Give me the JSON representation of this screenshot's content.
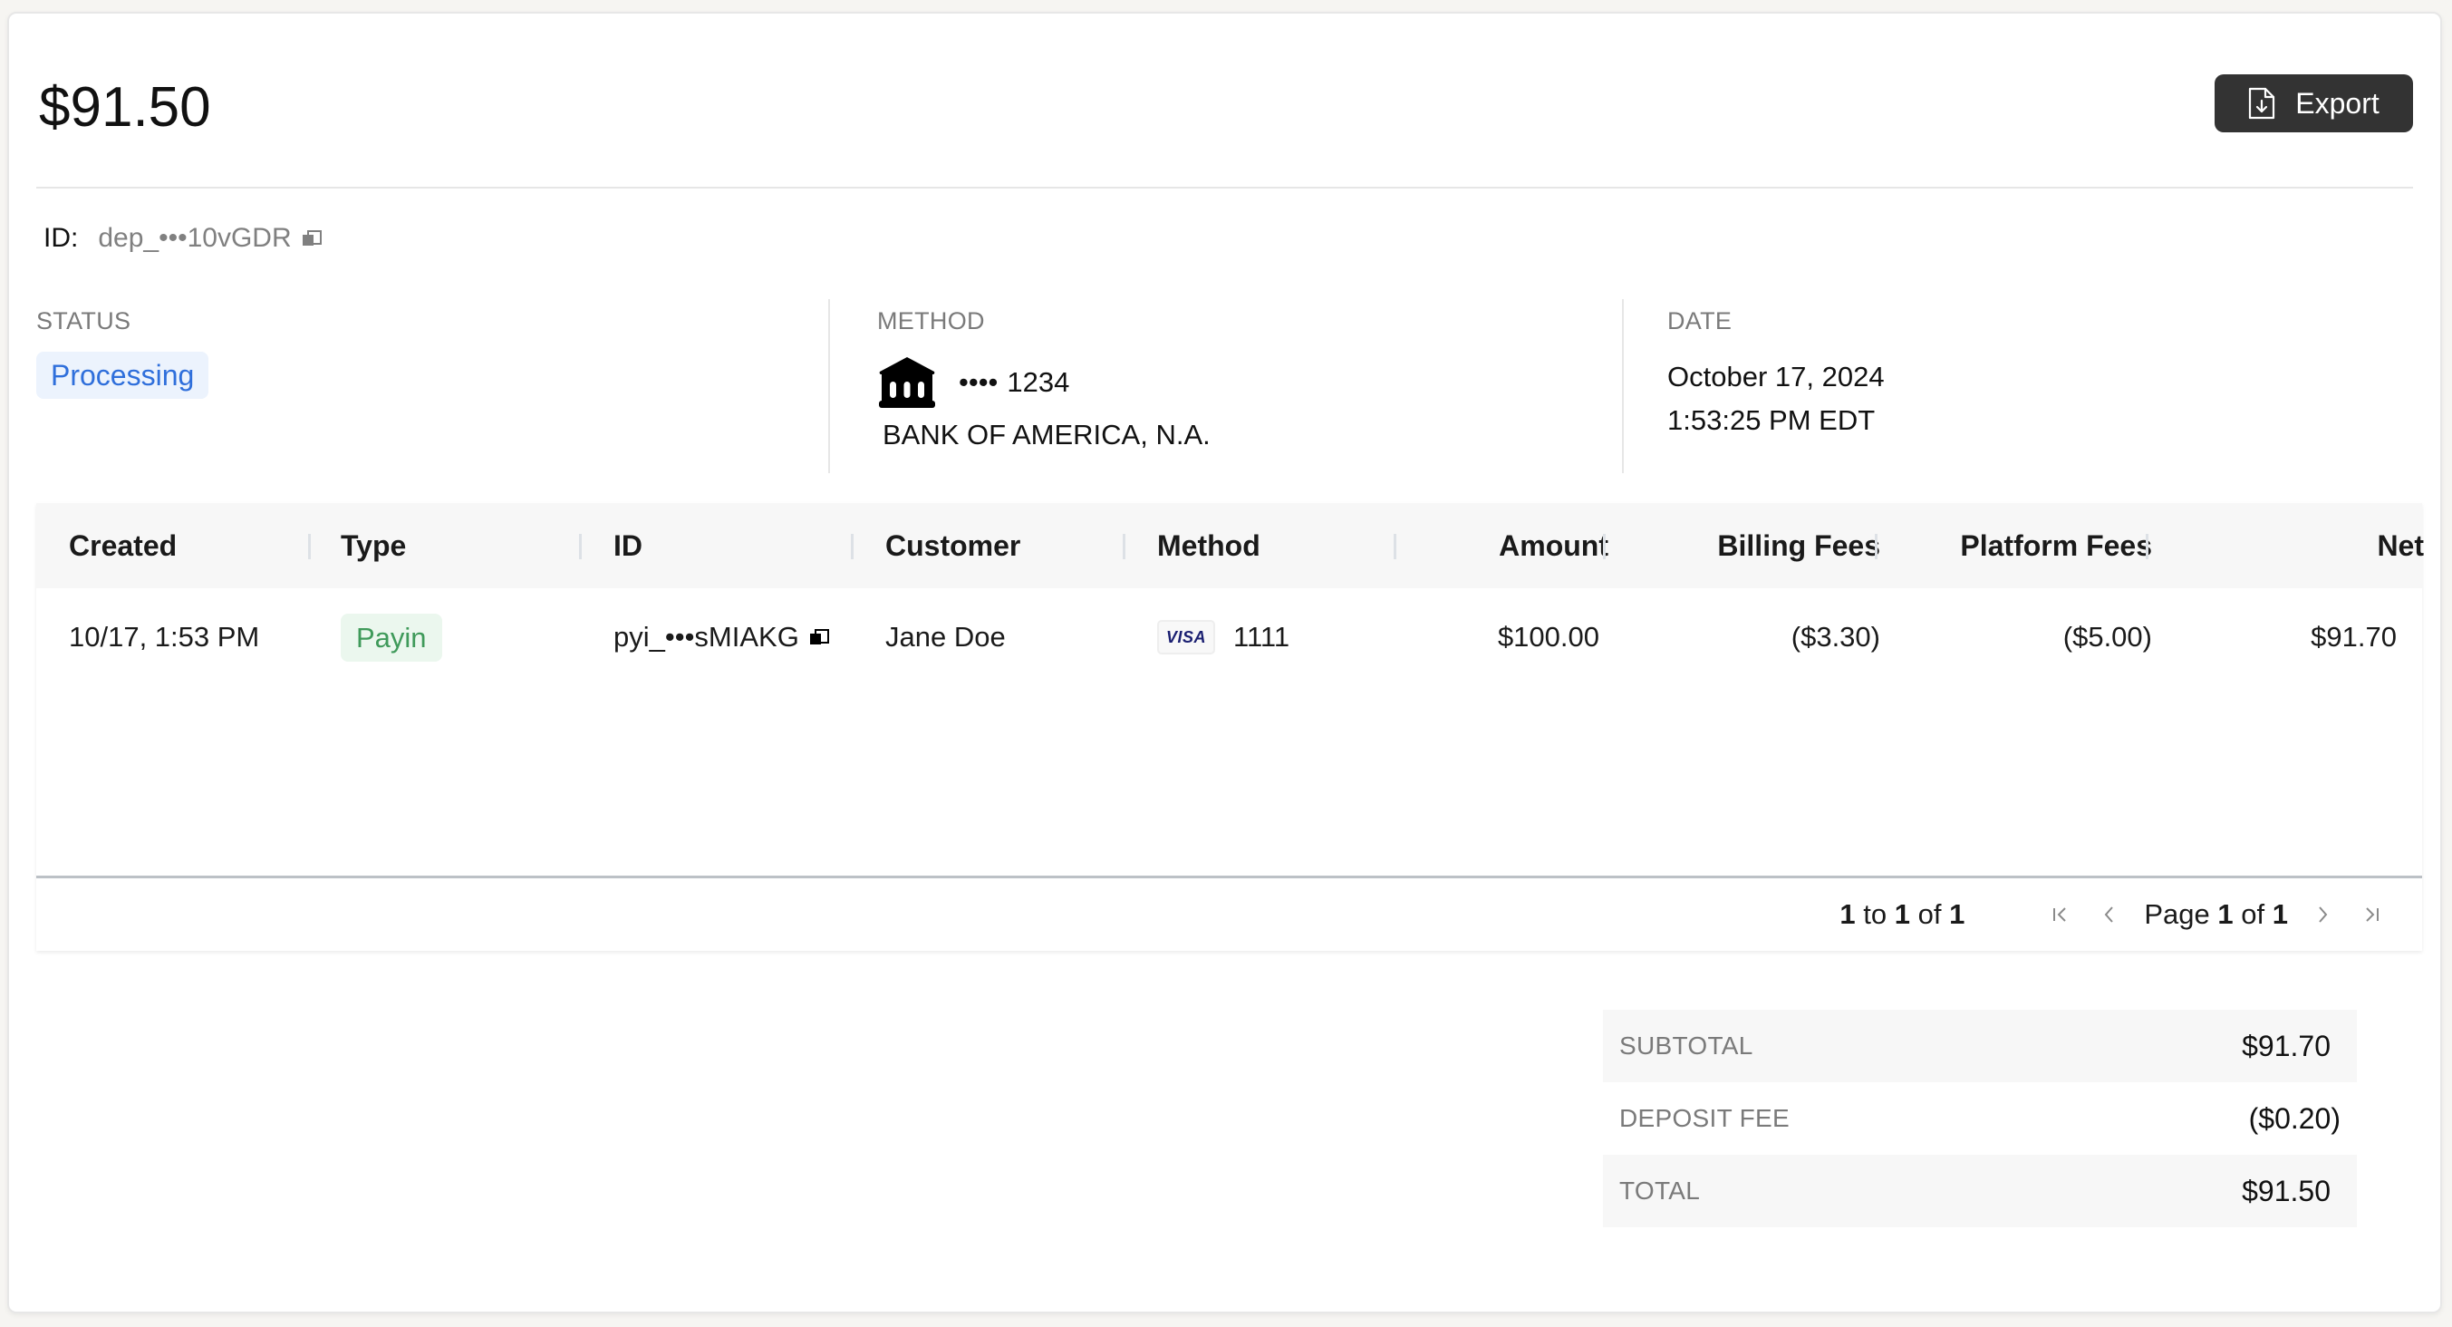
{
  "header": {
    "amount": "$91.50",
    "export_label": "Export",
    "export_icon": "file-download-icon"
  },
  "identifier": {
    "label": "ID:",
    "value": "dep_•••10vGDR",
    "copy_icon": "copy-icon"
  },
  "info": {
    "status": {
      "label": "STATUS",
      "value": "Processing",
      "color": "#2f6fdb",
      "bg": "#ecf3fd"
    },
    "method": {
      "label": "METHOD",
      "icon": "bank-icon",
      "mask": "••••",
      "last4": "1234",
      "bank_name": "BANK OF AMERICA, N.A."
    },
    "date": {
      "label": "DATE",
      "date": "October 17, 2024",
      "time": "1:53:25 PM EDT"
    }
  },
  "table": {
    "columns": [
      "Created",
      "Type",
      "ID",
      "Customer",
      "Method",
      "Amount",
      "Billing Fees",
      "Platform Fees",
      "Net"
    ],
    "rows": [
      {
        "created": "10/17, 1:53 PM",
        "type": "Payin",
        "id": "pyi_•••sMIAKG",
        "customer": "Jane Doe",
        "method_brand": "VISA",
        "method_last4": "1111",
        "amount": "$100.00",
        "billing_fees": "($3.30)",
        "platform_fees": "($5.00)",
        "net": "$91.70"
      }
    ],
    "pagination": {
      "range_from": "1",
      "range_to_word": "to",
      "range_to": "1",
      "of_word": "of",
      "total": "1",
      "page_word": "Page",
      "page": "1",
      "pages": "1"
    }
  },
  "summary": [
    {
      "label": "SUBTOTAL",
      "value": "$91.70"
    },
    {
      "label": "DEPOSIT FEE",
      "value": "($0.20)"
    },
    {
      "label": "TOTAL",
      "value": "$91.50"
    }
  ],
  "colors": {
    "button_bg": "#333333",
    "payin_text": "#3f9a5a",
    "payin_bg": "#ebf7ee",
    "visa_blue": "#1a1f71"
  }
}
